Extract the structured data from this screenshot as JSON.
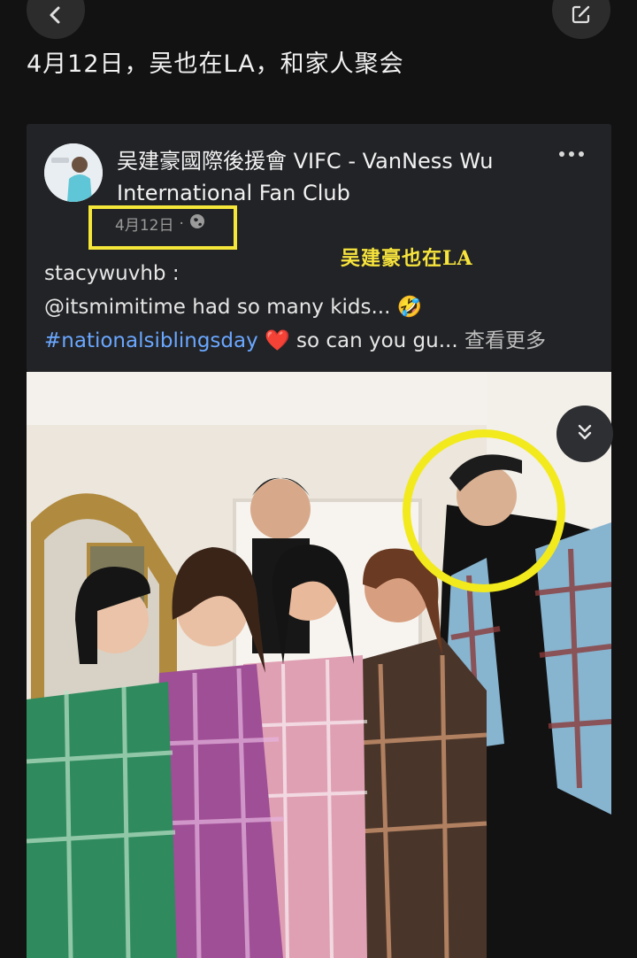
{
  "header": {
    "title": "4月12日，吴也在LA，和家人聚会"
  },
  "post": {
    "author": "吴建豪國際後援會 VIFC - VanNess Wu International Fan Club",
    "date": "4月12日",
    "date_separator": "·",
    "overlay_caption": "吴建豪也在LA",
    "text_line1": "stacywuvhb :",
    "text_line2_prefix": "@itsmimitime had so many kids...",
    "text_line2_emoji": "🤣",
    "hashtag": "#nationalsiblingsday",
    "heart_emoji": "❤️",
    "text_line3_suffix": "so can you gu...",
    "see_more": "查看更多"
  },
  "colors": {
    "background": "#121212",
    "card": "#222326",
    "hashtag": "#6aa7ff",
    "highlight": "#f2ea1d"
  },
  "icons": {
    "back": "chevron-left-icon",
    "edit": "edit-icon",
    "more": "more-horizontal-icon",
    "globe": "globe-icon",
    "scroll": "double-chevron-down-icon"
  }
}
